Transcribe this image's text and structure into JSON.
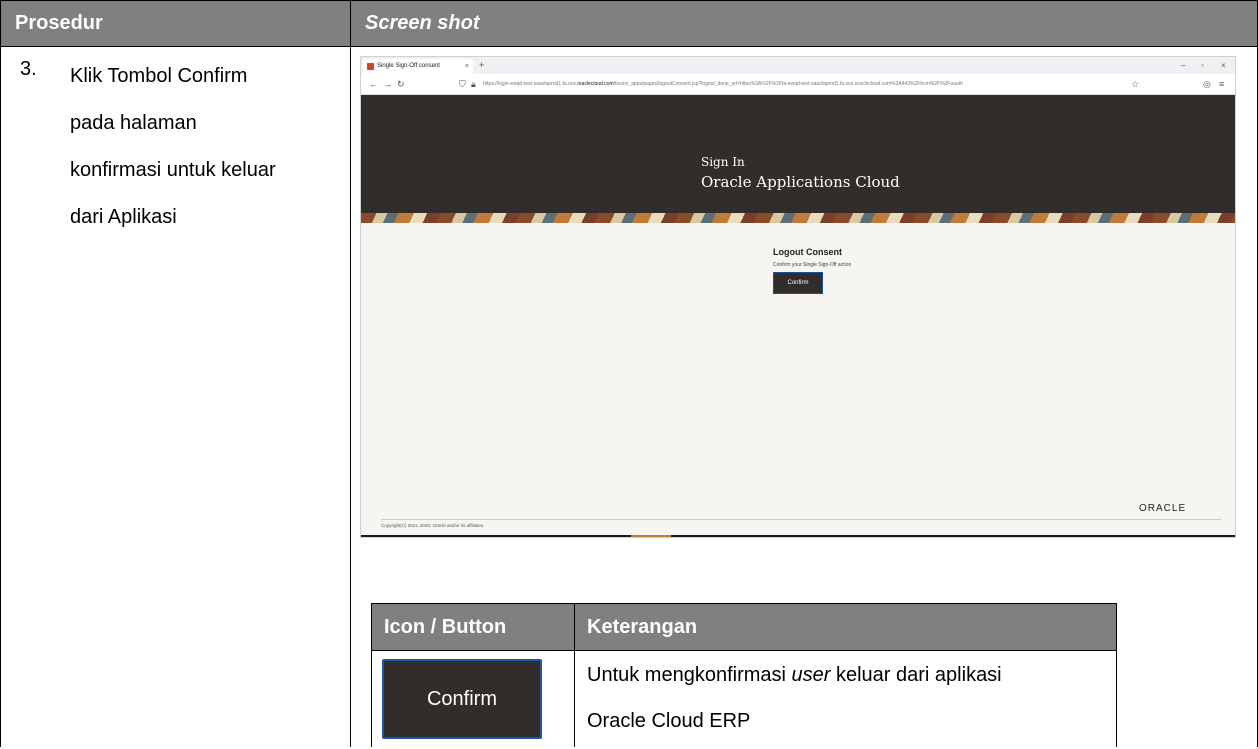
{
  "table": {
    "header_left": "Prosedur",
    "header_right": "Screen shot"
  },
  "step": {
    "number": "3.",
    "lines": [
      "Klik Tombol Confirm",
      "pada halaman",
      "konfirmasi untuk keluar",
      "dari Aplikasi"
    ]
  },
  "screenshot": {
    "tab_title": "Single Sign-Off consent",
    "tab_close": "×",
    "new_tab": "+",
    "url_prefix": "https://login-ewqd-test-saasfaprod1.fa.ocs.",
    "url_domain": "oraclecloud.com",
    "url_suffix": "/fusion_apps/pages/logoutConsent.jsp?logout_done_url=https%3A%2F%2Ffa-ewqd-test-saasfaprod1.fa.ocs.oraclecloud.com%3A443%2Fhcm%2F%2Foauth",
    "banner_line1": "Sign In",
    "banner_line2": "Oracle Applications Cloud",
    "consent_title": "Logout Consent",
    "consent_subtitle": "Confirm your Single Sign-Off action",
    "confirm_label": "Confirm",
    "logo_text": "ORACLE",
    "copyright": "Copyright(C) 2011, 2020, Oracle and/or its affiliates."
  },
  "legend": {
    "col1_header": "Icon / Button",
    "col2_header": "Keterangan",
    "button_label": "Confirm",
    "desc_line1_before": "Untuk mengkonfirmasi ",
    "desc_line1_italic": "user",
    "desc_line1_after": " keluar dari aplikasi",
    "desc_line2": "Oracle Cloud ERP"
  },
  "colors": {
    "header_gray": "#808080",
    "oracle_dark": "#312d2a",
    "button_border_blue": "#1a56b0"
  }
}
